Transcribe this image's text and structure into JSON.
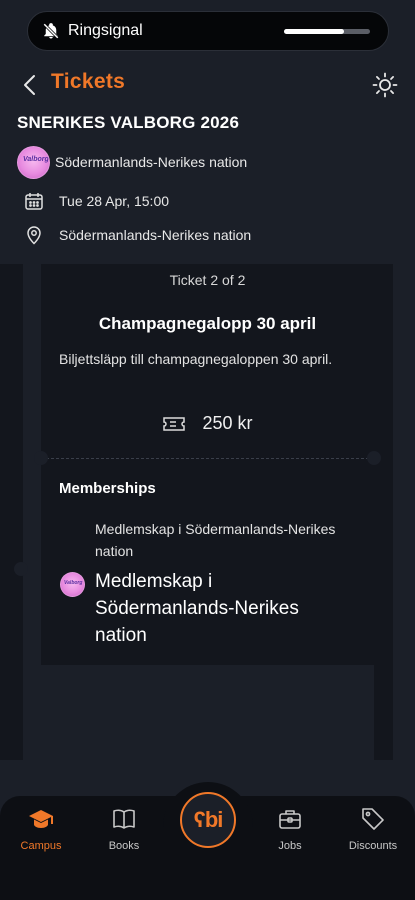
{
  "status": {
    "ring_label": "Ringsignal",
    "ring_level": 0.7
  },
  "header": {
    "title": "Tickets",
    "back_icon": "chevron-left-icon",
    "theme_icon": "sun-icon"
  },
  "event": {
    "title": "SNERIKES VALBORG 2026",
    "organizer": "Södermanlands-Nerikes nation",
    "date": "Tue 28 Apr, 15:00",
    "location": "Södermanlands-Nerikes nation"
  },
  "ticket": {
    "counter": "Ticket 2 of 2",
    "name": "Champagnegalopp 30 april",
    "description": "Biljettsläpp till champagnegaloppen 30 april.",
    "price": "250 kr"
  },
  "memberships": {
    "heading": "Memberships",
    "subtitle": "Medlemskap i Södermanlands-Nerikes nation",
    "name": "Medlemskap i Södermanlands-Nerikes nation"
  },
  "nav": {
    "items": [
      {
        "label": "Campus",
        "icon": "graduation-cap-icon",
        "active": true
      },
      {
        "label": "Books",
        "icon": "book-icon",
        "active": false
      },
      {
        "label": "Jobs",
        "icon": "briefcase-icon",
        "active": false
      },
      {
        "label": "Discounts",
        "icon": "tag-icon",
        "active": false
      }
    ],
    "center_logo": "ʕbi"
  },
  "colors": {
    "accent": "#f07829",
    "background": "#1b1f28",
    "card": "#13161d"
  }
}
